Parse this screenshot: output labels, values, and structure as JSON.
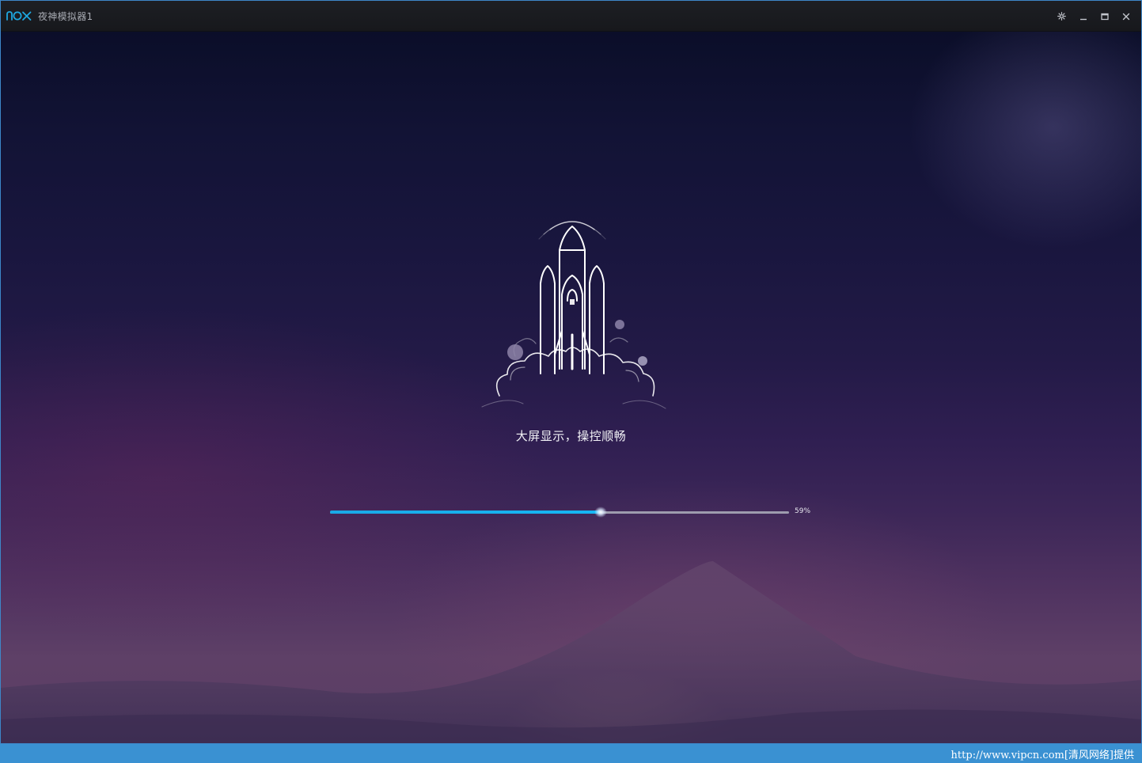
{
  "window": {
    "title": "夜神模拟器1",
    "logo": "nox"
  },
  "controls": {
    "settings_icon": "gear-icon",
    "minimize_icon": "minimize-icon",
    "maximize_icon": "maximize-icon",
    "close_icon": "close-icon"
  },
  "loading": {
    "tagline": "大屏显示，操控顺畅",
    "progress_percent": 59,
    "progress_label": "59%",
    "illustration": "rocket-icon"
  },
  "colors": {
    "accent": "#16b7f4",
    "titlebar": "#1b1c21",
    "frame_border": "#3d87c9"
  },
  "footer": {
    "watermark": "http://www.vipcn.com[清风网络]提供"
  }
}
